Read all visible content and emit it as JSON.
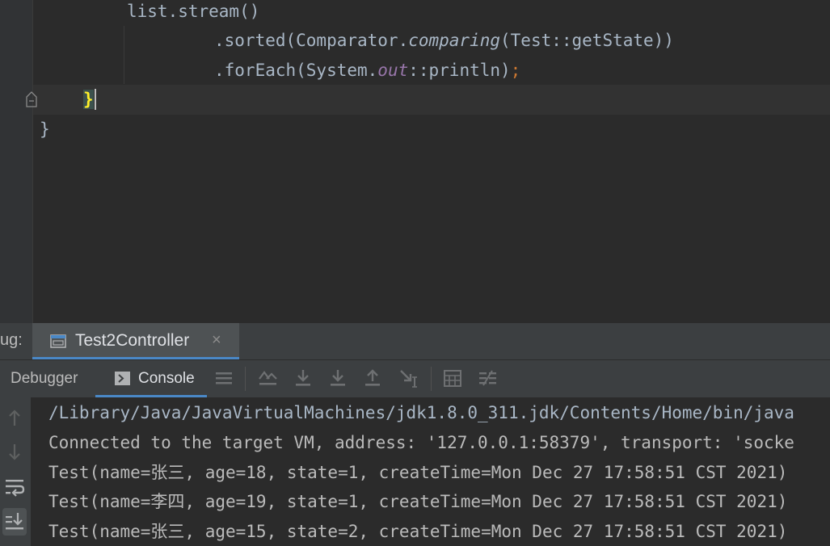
{
  "editor": {
    "line1": "list.stream()",
    "line2_prefix": ".sorted(Comparator.",
    "line2_italic": "comparing",
    "line2_suffix": "(Test::getState))",
    "line3_prefix": ".forEach(System.",
    "line3_static": "out",
    "line3_suffix": "::println)",
    "line3_semi": ";",
    "line4_brace": "}",
    "line5_brace": "}"
  },
  "debug": {
    "label": "ug:",
    "session_title": "Test2Controller",
    "close_glyph": "×"
  },
  "toolbar": {
    "tab_debugger": "Debugger",
    "tab_console": "Console",
    "icons": [
      "menu-icon",
      "show-execution-point-icon",
      "step-over-icon",
      "step-into-icon",
      "step-out-icon",
      "run-to-cursor-icon",
      "evaluate-expression-icon",
      "trace-current-stream-icon"
    ]
  },
  "console": {
    "lines": [
      "/Library/Java/JavaVirtualMachines/jdk1.8.0_311.jdk/Contents/Home/bin/java",
      "Connected to the target VM, address: '127.0.0.1:58379', transport: 'socke",
      "Test(name=张三, age=18, state=1, createTime=Mon Dec 27 17:58:51 CST 2021)",
      "Test(name=李四, age=19, state=1, createTime=Mon Dec 27 17:58:51 CST 2021)",
      "Test(name=张三, age=15, state=2, createTime=Mon Dec 27 17:58:51 CST 2021)"
    ]
  },
  "colors": {
    "editor_bg": "#2b2b2b",
    "panel_bg": "#3c3f41",
    "accent": "#4a88c7",
    "brace_match": "#ffef28"
  }
}
